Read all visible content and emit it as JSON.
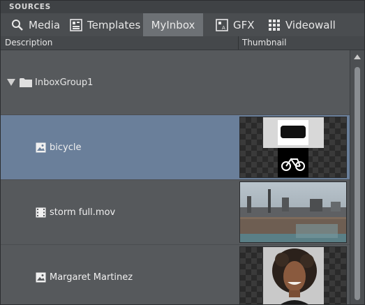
{
  "panel": {
    "title": "SOURCES"
  },
  "tabs": [
    {
      "label": "Media",
      "icon": "search-icon"
    },
    {
      "label": "Templates",
      "icon": "templates-icon"
    },
    {
      "label": "MyInbox",
      "icon": "",
      "active": true
    },
    {
      "label": "GFX",
      "icon": "gfx-icon"
    },
    {
      "label": "Videowall",
      "icon": "videowall-icon"
    }
  ],
  "columns": {
    "description": "Description",
    "thumbnail": "Thumbnail"
  },
  "group": {
    "label": "InboxGroup1",
    "expanded": true
  },
  "items": [
    {
      "name": "bicycle",
      "type": "image",
      "selected": true
    },
    {
      "name": "storm full.mov",
      "type": "video",
      "selected": false
    },
    {
      "name": "Margaret Martinez",
      "type": "image",
      "selected": false
    }
  ],
  "colors": {
    "selection": "#6a7f9a",
    "panel": "#56595c",
    "active_tab": "#6d7175"
  }
}
